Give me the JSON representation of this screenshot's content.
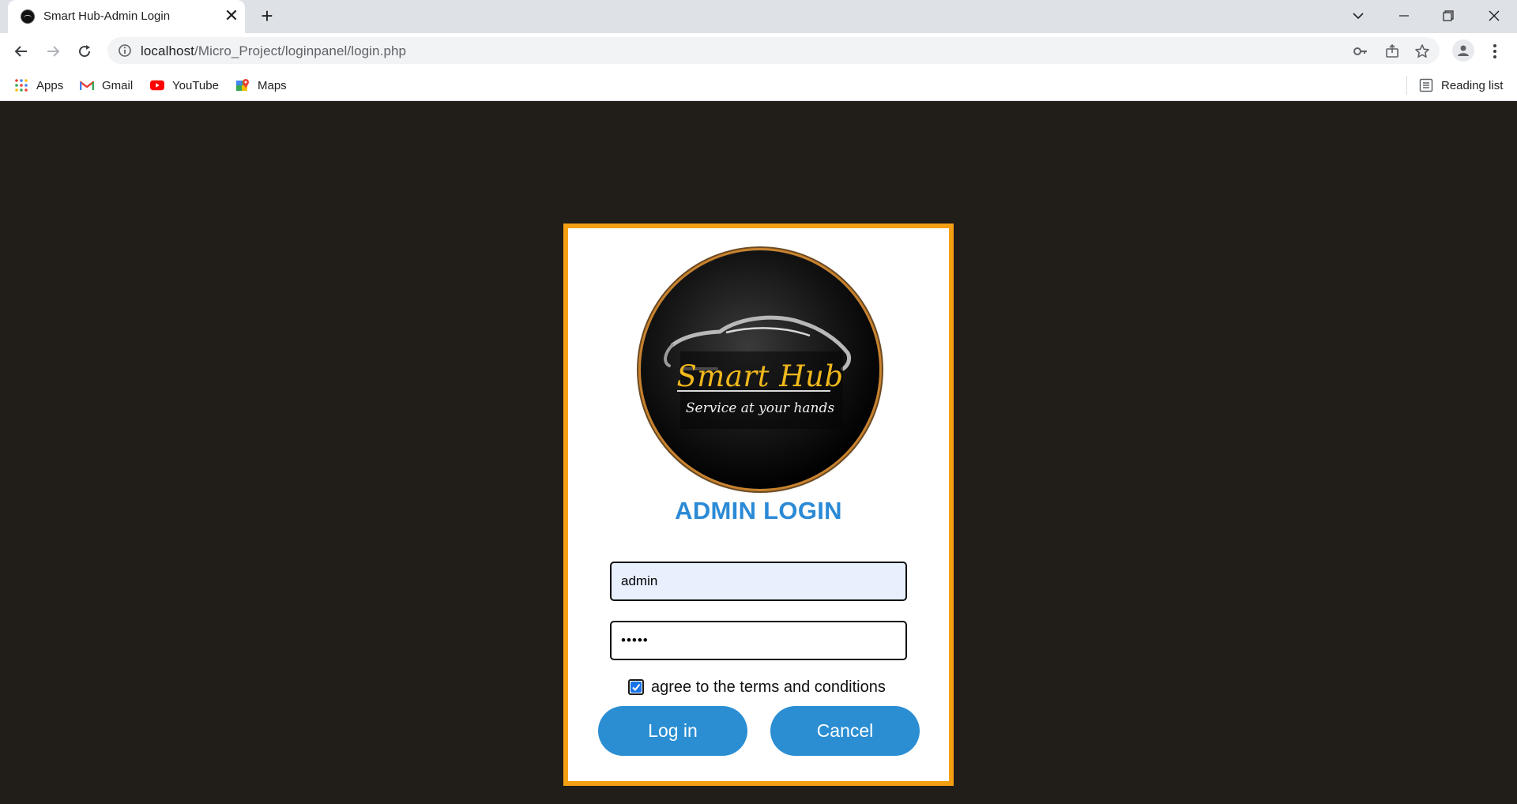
{
  "browser": {
    "tab_title": "Smart Hub-Admin Login",
    "tab_close": "✕",
    "new_tab": "+",
    "url_host": "localhost",
    "url_path": "/Micro_Project/loginpanel/login.php",
    "bookmarks": [
      {
        "label": "Apps",
        "icon": "apps-grid-icon"
      },
      {
        "label": "Gmail",
        "icon": "gmail-icon"
      },
      {
        "label": "YouTube",
        "icon": "youtube-icon"
      },
      {
        "label": "Maps",
        "icon": "maps-icon"
      }
    ],
    "reading_list": "Reading list"
  },
  "login": {
    "logo_title": "Smart Hub",
    "logo_tagline": "Service at your hands",
    "heading": "ADMIN LOGIN",
    "username_value": "admin",
    "password_value": "•••••",
    "agree_label": "agree to the terms and conditions",
    "agree_checked": true,
    "login_button": "Log in",
    "cancel_button": "Cancel"
  },
  "colors": {
    "page_background": "#211d18",
    "card_border": "#f5a012",
    "heading": "#2b8ad6",
    "button": "#2b8ed3",
    "autofill_field": "#e8f0fe"
  }
}
